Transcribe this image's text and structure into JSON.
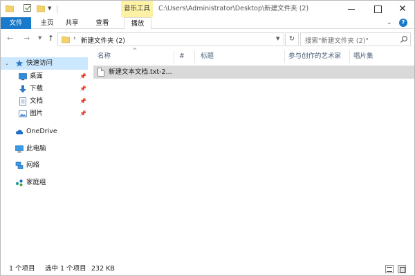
{
  "titlebar": {
    "context_tab": "音乐工具",
    "path": "C:\\Users\\Administrator\\Desktop\\新建文件夹 (2)"
  },
  "ribbon": {
    "tabs": [
      "文件",
      "主页",
      "共享",
      "查看",
      "播放"
    ],
    "active_tab": "播放"
  },
  "address": {
    "breadcrumb": "新建文件夹 (2)",
    "search_placeholder": "搜索\"新建文件夹 (2)\""
  },
  "navpane": {
    "items": [
      {
        "label": "快速访问",
        "icon": "star-icon",
        "selected": true
      },
      {
        "label": "桌面",
        "icon": "desktop-icon",
        "pinned": true
      },
      {
        "label": "下载",
        "icon": "download-icon",
        "pinned": true
      },
      {
        "label": "文档",
        "icon": "document-icon",
        "pinned": true
      },
      {
        "label": "图片",
        "icon": "pictures-icon",
        "pinned": true
      },
      {
        "label": "OneDrive",
        "icon": "cloud-icon"
      },
      {
        "label": "此电脑",
        "icon": "computer-icon"
      },
      {
        "label": "网络",
        "icon": "network-icon"
      },
      {
        "label": "家庭组",
        "icon": "homegroup-icon"
      }
    ]
  },
  "list": {
    "columns": [
      "名称",
      "#",
      "标题",
      "参与创作的艺术家",
      "唱片集"
    ],
    "rows": [
      {
        "name": "新建文本文档.txt-2..."
      }
    ]
  },
  "status": {
    "item_count": "1 个项目",
    "selected": "选中 1 个项目",
    "size": "232 KB"
  },
  "colors": {
    "accent": "#1979ca",
    "context_tab_bg": "#fdf1a6",
    "nav_selected": "#cce8ff",
    "row_selected": "#d9d9d9"
  }
}
